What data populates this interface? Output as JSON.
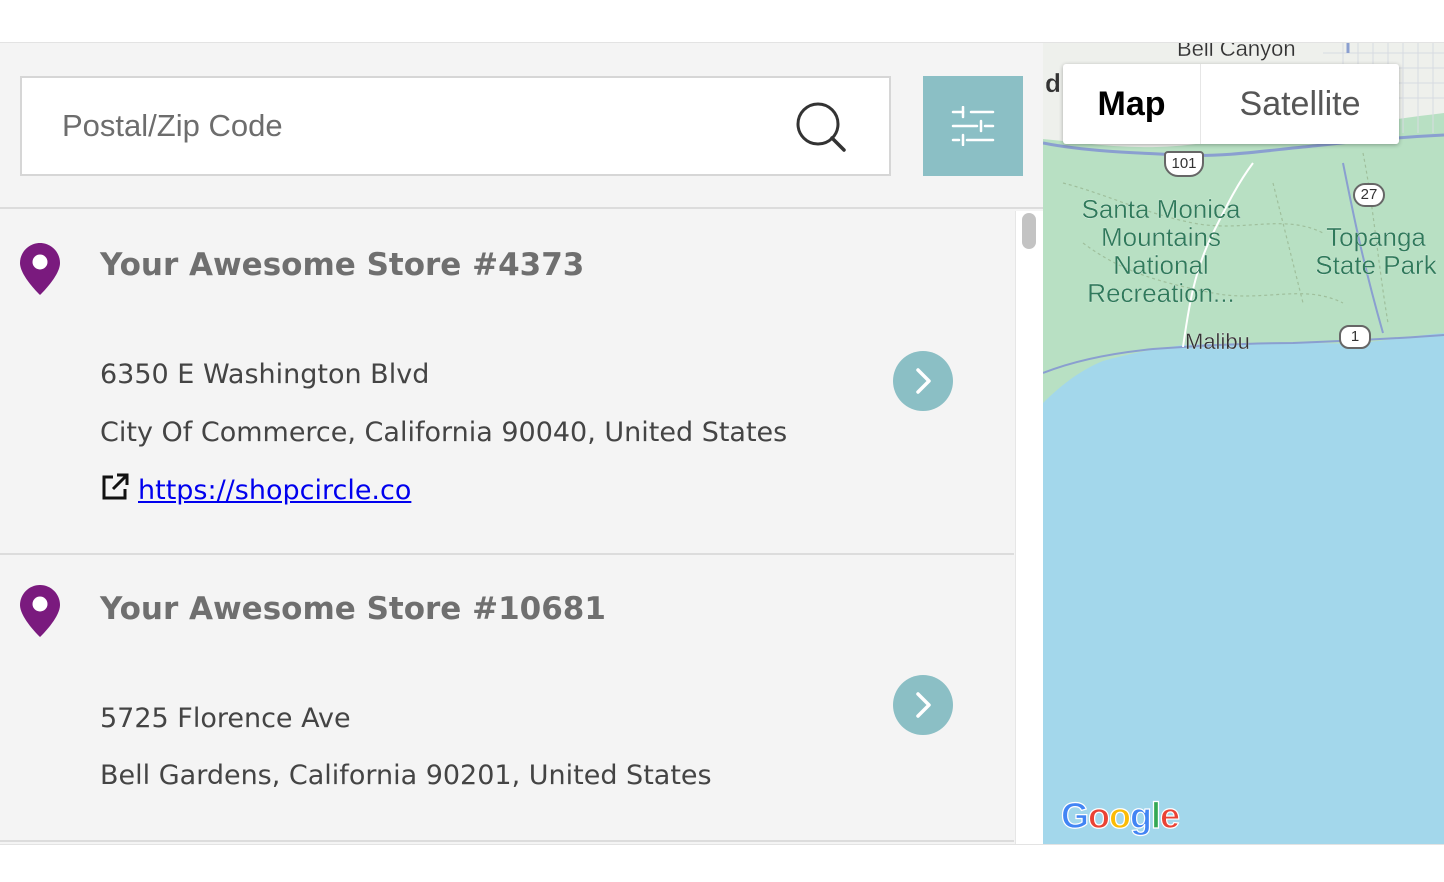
{
  "search": {
    "placeholder": "Postal/Zip Code",
    "value": ""
  },
  "icons": {
    "search": "search-icon",
    "filter": "sliders-icon",
    "pin": "map-pin-icon",
    "external_link": "external-link-icon",
    "chevron": "chevron-right-icon"
  },
  "colors": {
    "accent": "#8bbfc5",
    "pin": "#7a1a7e",
    "link": "#0000ee",
    "panel_bg": "#f4f4f4",
    "water": "#a3d7eb",
    "land": "#b8e0c3"
  },
  "stores": [
    {
      "name": "Your Awesome Store #4373",
      "address_line1": "6350 E Washington Blvd",
      "address_line2": "City Of Commerce, California 90040, United States",
      "website": "https://shopcircle.co"
    },
    {
      "name": "Your Awesome Store #10681",
      "address_line1": "5725 Florence Ave",
      "address_line2": "Bell Gardens, California 90201, United States"
    }
  ],
  "map": {
    "type_control": {
      "options": [
        "Map",
        "Satellite"
      ],
      "selected": "Map"
    },
    "labels": {
      "bell_canyon": "Bell Canyon",
      "santa_monica_mountains": [
        "Santa Monica",
        "Mountains",
        "National",
        "Recreation..."
      ],
      "topanga": [
        "Topanga",
        "State Park"
      ],
      "malibu": "Malibu",
      "cut_off_letter": "d"
    },
    "route_shields": [
      "101",
      "27",
      "1"
    ],
    "attribution": "Google"
  }
}
